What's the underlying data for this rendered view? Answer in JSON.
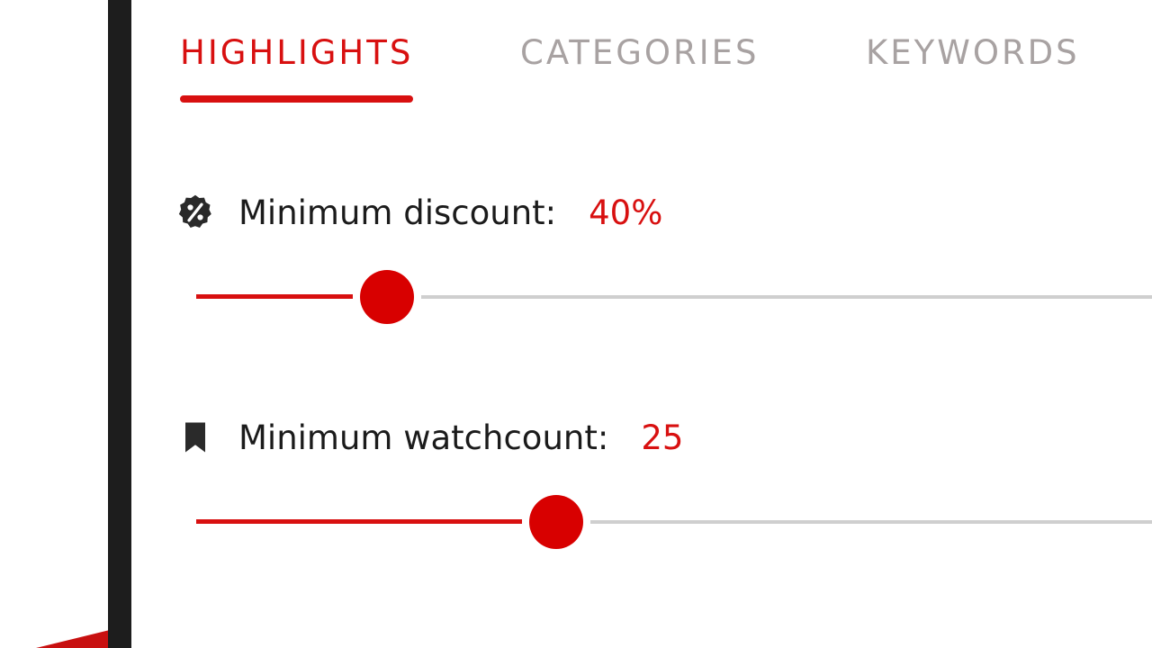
{
  "tabs": [
    {
      "label": "HIGHLIGHTS",
      "active": true
    },
    {
      "label": "CATEGORIES",
      "active": false
    },
    {
      "label": "KEYWORDS",
      "active": false
    }
  ],
  "filters": {
    "discount": {
      "label": "Minimum discount:",
      "value_text": "40%",
      "icon": "discount-badge-icon",
      "level": 0.2
    },
    "watchcount": {
      "label": "Minimum watchcount:",
      "value_text": "25",
      "icon": "bookmark-icon",
      "level": 0.377
    }
  },
  "colors": {
    "accent": "#d81010",
    "inactive_tab": "#a8a2a2",
    "rail": "#cfcfcf",
    "frame": "#1d1d1d"
  }
}
